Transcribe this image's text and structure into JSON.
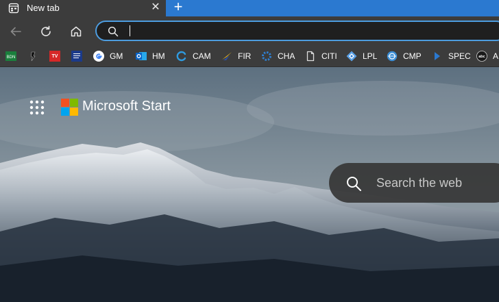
{
  "browser": {
    "tab": {
      "title": "New tab",
      "close_glyph": "✕"
    },
    "new_tab_glyph": "+",
    "toolbar": {
      "back_icon": "back-arrow-icon",
      "refresh_icon": "refresh-icon",
      "home_icon": "home-icon"
    },
    "omnibox": {
      "value": "",
      "placeholder": ""
    },
    "bookmarks": [
      {
        "label": "",
        "icon": "bdn-icon",
        "color": "#1a7f3c"
      },
      {
        "label": "",
        "icon": "dark-logo-icon",
        "color": "#111111"
      },
      {
        "label": "",
        "icon": "tv-guide-icon",
        "color": "#d62828"
      },
      {
        "label": "",
        "icon": "weather-channel-icon",
        "color": "#1b3a8a"
      },
      {
        "label": "GM",
        "icon": "google-icon",
        "color": "#4285f4"
      },
      {
        "label": "HM",
        "icon": "outlook-icon",
        "color": "#0a64c8"
      },
      {
        "label": "CAM",
        "icon": "loading-ring-icon",
        "color": "#2f9be0"
      },
      {
        "label": "FIR",
        "icon": "yellow-swoosh-icon",
        "color": "#e8b420"
      },
      {
        "label": "CHA",
        "icon": "gear-flower-icon",
        "color": "#2f7fd0"
      },
      {
        "label": "CITI",
        "icon": "document-icon",
        "color": "#e0e0e0"
      },
      {
        "label": "LPL",
        "icon": "diamond-icon",
        "color": "#5aa0e6"
      },
      {
        "label": "CMP",
        "icon": "globe-icon",
        "color": "#3b8ed6"
      },
      {
        "label": "SPEC",
        "icon": "play-icon",
        "color": "#2b79d0"
      },
      {
        "label": "A",
        "icon": "abc-icon",
        "color": "#1a1a1a"
      }
    ]
  },
  "start_page": {
    "brand": "Microsoft Start",
    "search_placeholder": "Search the web"
  }
}
